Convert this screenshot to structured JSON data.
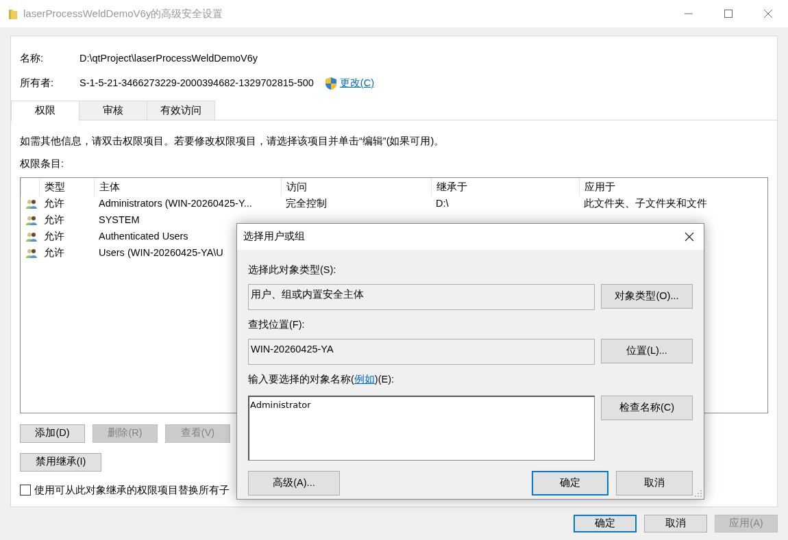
{
  "window": {
    "title": "laserProcessWeldDemoV6y的高级安全设置"
  },
  "info": {
    "name_label": "名称:",
    "name_value": "D:\\qtProject\\laserProcessWeldDemoV6y",
    "owner_label": "所有者:",
    "owner_value": "S-1-5-21-3466273229-2000394682-1329702815-500",
    "change_link": "更改(C)"
  },
  "tabs": [
    {
      "label": "权限",
      "selected": true
    },
    {
      "label": "审核",
      "selected": false
    },
    {
      "label": "有效访问",
      "selected": false
    }
  ],
  "description": "如需其他信息，请双击权限项目。若要修改权限项目，请选择该项目并单击“编辑”(如果可用)。",
  "entries_label": "权限条目:",
  "table": {
    "columns": [
      "类型",
      "主体",
      "访问",
      "继承于",
      "应用于"
    ],
    "rows": [
      {
        "type": "允许",
        "principal": "Administrators (WIN-20260425-Y...",
        "access": "完全控制",
        "inherited_from": "D:\\",
        "applies_to": "此文件夹、子文件夹和文件"
      },
      {
        "type": "允许",
        "principal": "SYSTEM"
      },
      {
        "type": "允许",
        "principal": "Authenticated Users"
      },
      {
        "type": "允许",
        "principal": "Users (WIN-20260425-YA\\U"
      }
    ]
  },
  "buttons": [
    {
      "label": "添加(D)",
      "disabled": false
    },
    {
      "label": "删除(R)",
      "disabled": true
    },
    {
      "label": "查看(V)",
      "disabled": true
    }
  ],
  "inheritance_button": "禁用继承(I)",
  "replace_checkbox": {
    "label": "使用可从此对象继承的权限项目替换所有子",
    "checked": false
  },
  "footer_buttons": [
    {
      "label": "确定",
      "default": true,
      "disabled": false
    },
    {
      "label": "取消",
      "default": false,
      "disabled": false
    },
    {
      "label": "应用(A)",
      "default": false,
      "disabled": true
    }
  ],
  "dialog": {
    "title": "选择用户或组",
    "object_type_label": "选择此对象类型(S):",
    "object_type_value": "用户、组或内置安全主体",
    "object_type_button": "对象类型(O)...",
    "location_label": "查找位置(F):",
    "location_value": "WIN-20260425-YA",
    "location_button": "位置(L)...",
    "names_label_before": "输入要选择的对象名称(",
    "names_label_link": "例如",
    "names_label_after": ")(E):",
    "names_value": "Administrator",
    "check_names_button": "检查名称(C)",
    "advanced_button": "高级(A)...",
    "buttons": [
      {
        "label": "确定",
        "default": true
      },
      {
        "label": "取消",
        "default": false
      }
    ]
  }
}
